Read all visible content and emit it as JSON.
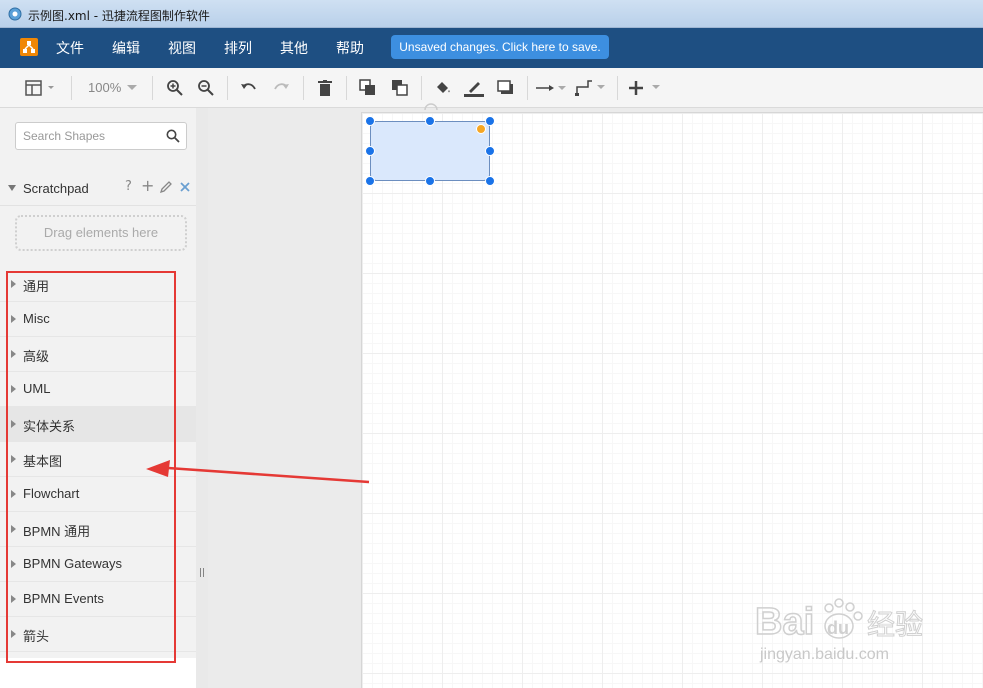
{
  "window": {
    "title": "示例图.xml - 迅捷流程图制作软件"
  },
  "menu": {
    "items": [
      "文件",
      "编辑",
      "视图",
      "排列",
      "其他",
      "帮助"
    ],
    "save_notice": "Unsaved changes. Click here to save."
  },
  "toolbar": {
    "zoom": "100%"
  },
  "sidebar": {
    "search_placeholder": "Search Shapes",
    "scratchpad": {
      "label": "Scratchpad",
      "help": "?",
      "add": "+",
      "drop_hint": "Drag elements here"
    },
    "categories": [
      "通用",
      "Misc",
      "高级",
      "UML",
      "实体关系",
      "基本图",
      "Flowchart",
      "BPMN 通用",
      "BPMN Gateways",
      "BPMN Events",
      "箭头"
    ]
  },
  "watermark": {
    "url": "jingyan.baidu.com",
    "brand": "Bai",
    "brand2": "du",
    "brand3": "经验"
  },
  "colors": {
    "menubar": "#1e4f82",
    "accent": "#3d8fe0",
    "annotation": "#e53935",
    "shape_fill": "#dae8fc",
    "shape_stroke": "#6c8ebf"
  },
  "icons": [
    "app-icon",
    "logo-icon",
    "format-panel-icon",
    "zoom-in-icon",
    "zoom-out-icon",
    "undo-icon",
    "redo-icon",
    "delete-icon",
    "to-front-icon",
    "to-back-icon",
    "fill-color-icon",
    "line-color-icon",
    "shadow-icon",
    "connection-icon",
    "waypoints-icon",
    "insert-icon",
    "search-icon",
    "edit-icon",
    "close-icon"
  ]
}
